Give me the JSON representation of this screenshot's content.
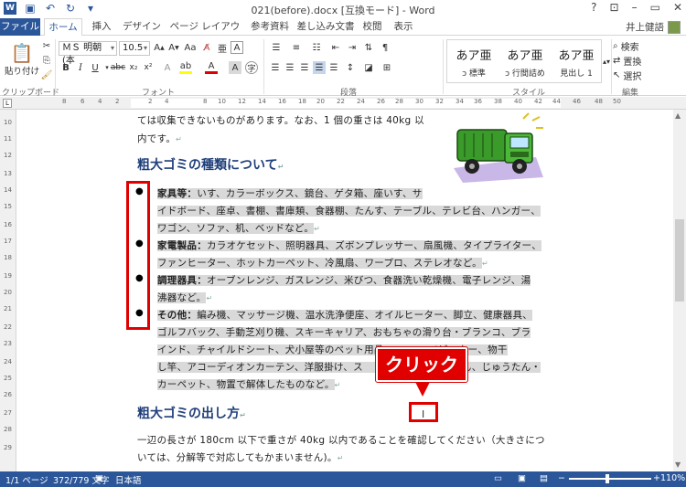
{
  "titlebar": {
    "title": "021(before).docx [互換モード] - Word",
    "help": "?",
    "minimize": "–",
    "restore": "▭",
    "close": "✕"
  },
  "tabs": [
    "ファイル",
    "ホーム",
    "挿入",
    "デザイン",
    "ページ レイアウト",
    "参考資料",
    "差し込み文書",
    "校閲",
    "表示"
  ],
  "user": {
    "name": "井上健語"
  },
  "ribbon": {
    "paste": "貼り付け",
    "clipboard_label": "クリップボード",
    "font_name": "ＭＳ 明朝 (本",
    "font_size": "10.5",
    "font_label": "フォント",
    "paragraph_label": "段落",
    "styles": [
      {
        "sample": "あア亜",
        "name": "ↄ 標準"
      },
      {
        "sample": "あア亜",
        "name": "ↄ 行間詰め"
      },
      {
        "sample": "あア亜",
        "name": "見出し 1"
      }
    ],
    "styles_label": "スタイル",
    "search": "検索",
    "replace": "置換",
    "select": "選択",
    "editing_label": "編集"
  },
  "document": {
    "intro1": "ては収集できないものがあります。なお、1 個の重さは 40kg 以",
    "intro2": "内です。",
    "heading1": "粗大ゴミの種類について",
    "items": [
      {
        "label": "家具等：",
        "lines": [
          "いす、カラーボックス、鏡台、ゲタ箱、座いす、サ",
          "イドボード、座卓、書棚、書庫類、食器棚、たんす、テーブル、テレビ台、ハンガー、",
          "ワゴン、ソファ、机、ベッドなど。"
        ]
      },
      {
        "label": "家電製品：",
        "lines": [
          "カラオケセット、照明器具、ズボンプレッサー、扇風機、タイプライター、",
          "ファンヒーター、ホットカーペット、冷風扇、ワープロ、ステレオなど。"
        ]
      },
      {
        "label": "調理器具：",
        "lines": [
          "オーブンレンジ、ガスレンジ、米びつ、食器洗い乾燥機、電子レンジ、湯",
          "沸器など。"
        ]
      },
      {
        "label": "その他：",
        "lines": [
          "編み機、マッサージ機、温水洗浄便座、オイルヒーター、脚立、健康器具、",
          "ゴルフバック、手動芝刈り機、スキーキャリア、おもちゃの滑り台・ブランコ、ブラ",
          "インド、チャイルドシート、犬小屋等のペット用品、　　　、ベビーカー、物干",
          "し竿、アコーディオンカーテン、洋服掛け、ス　　　　　　　　　　ん、じゅうたん・",
          "カーペット、物置で解体したものなど。"
        ]
      }
    ],
    "heading2": "粗大ゴミの出し方",
    "para1": "一辺の長さが 180cm 以下で重さが 40kg 以内であることを確認してください（大きさにつ",
    "para2": "いては、分解等で対応してもかまいません)。"
  },
  "callout": {
    "text": "クリック"
  },
  "statusbar": {
    "page": "1/1 ページ",
    "words": "372/779 文字",
    "lang": "日本語",
    "zoom_minus": "−",
    "zoom_plus": "+",
    "zoom": "110%"
  },
  "colors": {
    "accent": "#2b579a",
    "highlight": "#e00000",
    "selection": "#d9d9d9",
    "heading": "#1f3f7a"
  }
}
